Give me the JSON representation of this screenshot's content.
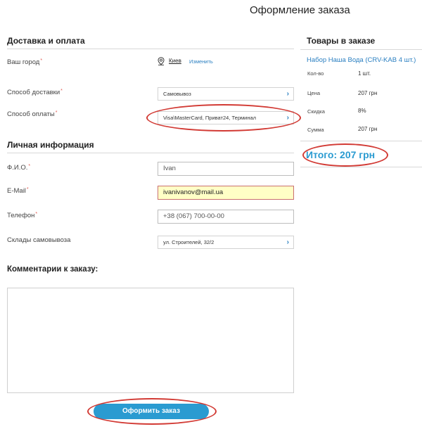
{
  "page": {
    "title": "Оформление заказа"
  },
  "delivery": {
    "section_title": "Доставка и оплата",
    "city_label": "Ваш город",
    "city_value": "Киев",
    "city_change": "Изменить",
    "delivery_label": "Способ доставки",
    "delivery_value": "Самовывоз",
    "payment_label": "Способ оплаты",
    "payment_value": "Visa\\MasterCard, Приват24, Терминал",
    "required_mark": "*"
  },
  "personal": {
    "section_title": "Личная информация",
    "name_label": "Ф.И.О.",
    "name_value": "Ivan",
    "email_label": "E-Mail",
    "email_value": "ivanivanov@mail.ua",
    "phone_label": "Телефон",
    "phone_value": "+38 (067) 700-00-00",
    "warehouse_label": "Склады самовывоза",
    "warehouse_value": "ул. Строителей, 32/2"
  },
  "comments": {
    "title": "Комментарии к заказу:"
  },
  "submit": {
    "label": "Оформить заказ"
  },
  "order": {
    "title": "Товары в заказе",
    "product": "Набор Наша Вода (CRV-KAB 4 шт.)",
    "rows": [
      {
        "key": "Кол-во",
        "value": "1 шт."
      },
      {
        "key": "Цена",
        "value": "207 грн"
      },
      {
        "key": "Скидка",
        "value": "8%"
      },
      {
        "key": "Сумма",
        "value": "207 грн"
      }
    ],
    "total": "Итого: 207 грн"
  },
  "icons": {
    "city": "map-pin-icon",
    "chevron": "chevron-right-icon"
  },
  "colors": {
    "accent": "#2a9bd1",
    "link": "#2a7fc1",
    "highlight": "#d23a34",
    "warning_bg": "#ffffc6"
  }
}
